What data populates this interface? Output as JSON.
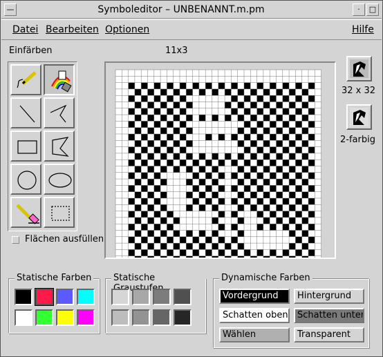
{
  "window": {
    "title": "Symboleditor – UNBENANNT.m.pm",
    "menu_icon": "window-menu-icon",
    "minimize_icon": "minimize-icon",
    "maximize_icon": "maximize-icon"
  },
  "menubar": {
    "datei": "Datei",
    "bearbeiten": "Bearbeiten",
    "optionen": "Optionen",
    "hilfe": "Hilfe"
  },
  "tool_name": "Einfärben",
  "grid_size_label": "11x3",
  "tools": [
    {
      "name": "pencil-tool",
      "icon": "pencil-icon"
    },
    {
      "name": "flood-fill-tool",
      "icon": "rainbow-fill-icon",
      "active": true
    },
    {
      "name": "line-tool",
      "icon": "line-icon"
    },
    {
      "name": "polyline-tool",
      "icon": "polyline-icon"
    },
    {
      "name": "rectangle-tool",
      "icon": "rectangle-icon"
    },
    {
      "name": "polygon-tool",
      "icon": "polygon-icon"
    },
    {
      "name": "circle-tool",
      "icon": "circle-icon"
    },
    {
      "name": "ellipse-tool",
      "icon": "ellipse-icon"
    },
    {
      "name": "eraser-tool",
      "icon": "eraser-icon"
    },
    {
      "name": "select-tool",
      "icon": "selection-rect-icon"
    }
  ],
  "fill_checkbox_label": "Flächen ausfüllen",
  "preview": {
    "large_label": "32 x 32",
    "small_label": "2-farbig"
  },
  "static_colors": {
    "title": "Statische Farben",
    "colors": [
      "#000000",
      "#ff1a4a",
      "#5a5aff",
      "#00ffff",
      "#ffffff",
      "#33ff33",
      "#ffff00",
      "#ff00ff"
    ],
    "selected_index": 1
  },
  "static_grays": {
    "title": "Statische Graustufen",
    "colors": [
      "#d6d6d6",
      "#a8a8a8",
      "#7c7c7c",
      "#505050",
      "#bcbcbc",
      "#939393",
      "#666666",
      "#262626"
    ]
  },
  "dynamic_colors": {
    "title": "Dynamische Farben",
    "buttons": [
      {
        "label": "Vordergrund",
        "bg": "#000000",
        "fg": "#ffffff"
      },
      {
        "label": "Hintergrund",
        "bg": "#d4d4d4",
        "fg": "#000000"
      },
      {
        "label": "Schatten oben",
        "bg": "#ffffff",
        "fg": "#000000"
      },
      {
        "label": "Schatten unten",
        "bg": "#7a7a7a",
        "fg": "#000000"
      },
      {
        "label": "Wählen",
        "bg": "#b0b0b0",
        "fg": "#000000"
      },
      {
        "label": "Transparent",
        "bg": "#d4d4d4",
        "fg": "#000000"
      }
    ]
  }
}
